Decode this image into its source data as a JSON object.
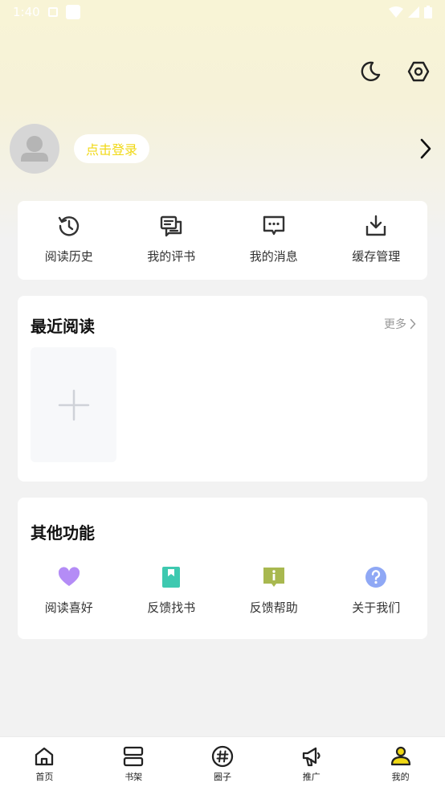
{
  "status": {
    "time": "1:40"
  },
  "profile": {
    "login_label": "点击登录"
  },
  "quick_actions": [
    {
      "label": "阅读历史",
      "icon": "history-icon"
    },
    {
      "label": "我的评书",
      "icon": "comment-book-icon"
    },
    {
      "label": "我的消息",
      "icon": "message-icon"
    },
    {
      "label": "缓存管理",
      "icon": "download-icon"
    }
  ],
  "recent": {
    "title": "最近阅读",
    "more_label": "更多"
  },
  "other": {
    "title": "其他功能",
    "items": [
      {
        "label": "阅读喜好",
        "icon": "heart-icon",
        "color": "#b48cf6"
      },
      {
        "label": "反馈找书",
        "icon": "bookmark-icon",
        "color": "#3ec9b0"
      },
      {
        "label": "反馈帮助",
        "icon": "info-icon",
        "color": "#a8b84f"
      },
      {
        "label": "关于我们",
        "icon": "question-icon",
        "color": "#8fa8f5"
      }
    ]
  },
  "tabbar": [
    {
      "label": "首页",
      "icon": "home-icon"
    },
    {
      "label": "书架",
      "icon": "bookshelf-icon"
    },
    {
      "label": "圈子",
      "icon": "hashtag-icon"
    },
    {
      "label": "推广",
      "icon": "megaphone-icon"
    },
    {
      "label": "我的",
      "icon": "profile-icon",
      "active": true
    }
  ],
  "colors": {
    "accent": "#f0d814",
    "background": "#f2f2f2"
  }
}
